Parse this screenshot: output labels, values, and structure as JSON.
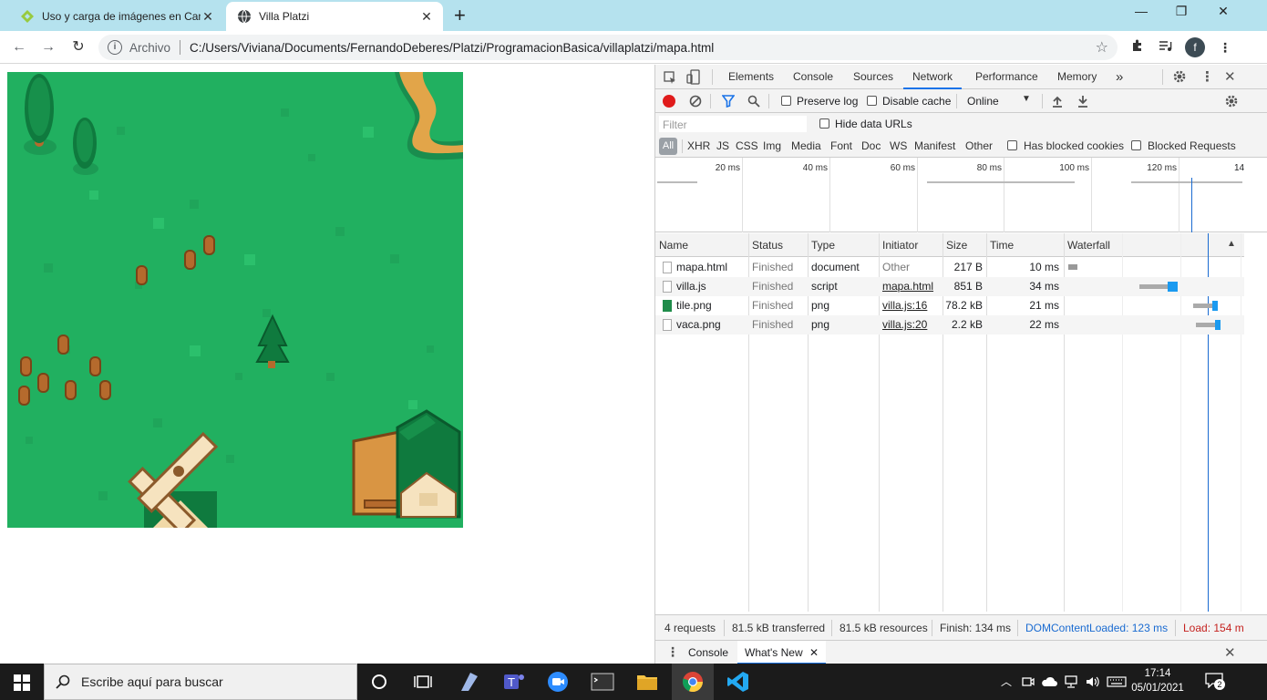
{
  "browser": {
    "tabs": [
      {
        "title": "Uso y carga de imágenes en Can",
        "active": false
      },
      {
        "title": "Villa Platzi",
        "active": true
      }
    ],
    "window_controls": {
      "minimize": "—",
      "maximize": "❐",
      "close": "✕"
    },
    "address": {
      "protocol_label": "Archivo",
      "url": "C:/Users/Viviana/Documents/FernandoDeberes/Platzi/ProgramacionBasica/villaplatzi/mapa.html"
    },
    "profile_initial": "f"
  },
  "devtools": {
    "tabs": [
      "Elements",
      "Console",
      "Sources",
      "Network",
      "Performance",
      "Memory"
    ],
    "active_tab": "Network",
    "more_tabs": "»",
    "options": {
      "preserve_log": "Preserve log",
      "disable_cache": "Disable cache",
      "throttling": "Online"
    },
    "filter": {
      "placeholder": "Filter",
      "hide_data_urls": "Hide data URLs"
    },
    "type_filters": [
      "All",
      "XHR",
      "JS",
      "CSS",
      "Img",
      "Media",
      "Font",
      "Doc",
      "WS",
      "Manifest",
      "Other"
    ],
    "blocked_cookies": "Has blocked cookies",
    "blocked_requests": "Blocked Requests",
    "overview_ticks": [
      "20 ms",
      "40 ms",
      "60 ms",
      "80 ms",
      "100 ms",
      "120 ms",
      "14"
    ],
    "columns": [
      "Name",
      "Status",
      "Type",
      "Initiator",
      "Size",
      "Time",
      "Waterfall"
    ],
    "requests": [
      {
        "name": "mapa.html",
        "status": "Finished",
        "type": "document",
        "initiator": "Other",
        "size": "217 B",
        "time": "10 ms"
      },
      {
        "name": "villa.js",
        "status": "Finished",
        "type": "script",
        "initiator": "mapa.html",
        "size": "851 B",
        "time": "34 ms"
      },
      {
        "name": "tile.png",
        "status": "Finished",
        "type": "png",
        "initiator": "villa.js:16",
        "size": "78.2 kB",
        "time": "21 ms"
      },
      {
        "name": "vaca.png",
        "status": "Finished",
        "type": "png",
        "initiator": "villa.js:20",
        "size": "2.2 kB",
        "time": "22 ms"
      }
    ],
    "summary": {
      "requests": "4 requests",
      "transferred": "81.5 kB transferred",
      "resources": "81.5 kB resources",
      "finish": "Finish: 134 ms",
      "dom_content_loaded": "DOMContentLoaded: 123 ms",
      "load": "Load: 154 m"
    },
    "drawer_tabs": [
      "Console",
      "What's New"
    ],
    "colors": {
      "accent": "#1a73e8",
      "dcl": "#1a6bd1",
      "load": "#c5221f",
      "record": "#e01b1b"
    }
  },
  "taskbar": {
    "search_placeholder": "Escribe aquí para buscar",
    "time": "17:14",
    "date": "05/01/2021",
    "notifications": "2"
  }
}
